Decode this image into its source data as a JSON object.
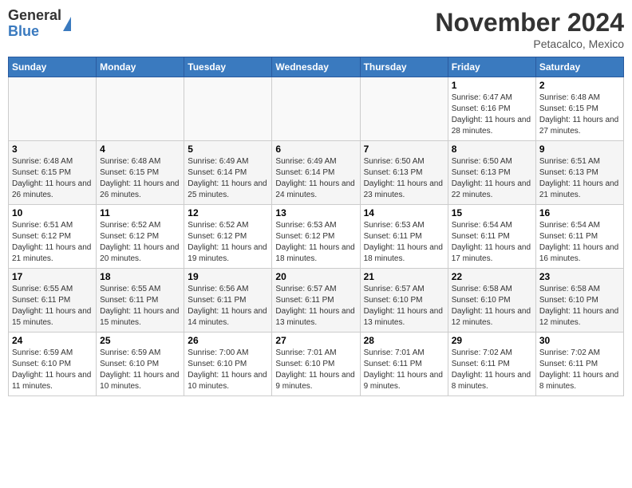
{
  "header": {
    "logo_general": "General",
    "logo_blue": "Blue",
    "month_title": "November 2024",
    "location": "Petacalco, Mexico"
  },
  "days_of_week": [
    "Sunday",
    "Monday",
    "Tuesday",
    "Wednesday",
    "Thursday",
    "Friday",
    "Saturday"
  ],
  "weeks": [
    [
      {
        "day": "",
        "info": ""
      },
      {
        "day": "",
        "info": ""
      },
      {
        "day": "",
        "info": ""
      },
      {
        "day": "",
        "info": ""
      },
      {
        "day": "",
        "info": ""
      },
      {
        "day": "1",
        "info": "Sunrise: 6:47 AM\nSunset: 6:16 PM\nDaylight: 11 hours and 28 minutes."
      },
      {
        "day": "2",
        "info": "Sunrise: 6:48 AM\nSunset: 6:15 PM\nDaylight: 11 hours and 27 minutes."
      }
    ],
    [
      {
        "day": "3",
        "info": "Sunrise: 6:48 AM\nSunset: 6:15 PM\nDaylight: 11 hours and 26 minutes."
      },
      {
        "day": "4",
        "info": "Sunrise: 6:48 AM\nSunset: 6:15 PM\nDaylight: 11 hours and 26 minutes."
      },
      {
        "day": "5",
        "info": "Sunrise: 6:49 AM\nSunset: 6:14 PM\nDaylight: 11 hours and 25 minutes."
      },
      {
        "day": "6",
        "info": "Sunrise: 6:49 AM\nSunset: 6:14 PM\nDaylight: 11 hours and 24 minutes."
      },
      {
        "day": "7",
        "info": "Sunrise: 6:50 AM\nSunset: 6:13 PM\nDaylight: 11 hours and 23 minutes."
      },
      {
        "day": "8",
        "info": "Sunrise: 6:50 AM\nSunset: 6:13 PM\nDaylight: 11 hours and 22 minutes."
      },
      {
        "day": "9",
        "info": "Sunrise: 6:51 AM\nSunset: 6:13 PM\nDaylight: 11 hours and 21 minutes."
      }
    ],
    [
      {
        "day": "10",
        "info": "Sunrise: 6:51 AM\nSunset: 6:12 PM\nDaylight: 11 hours and 21 minutes."
      },
      {
        "day": "11",
        "info": "Sunrise: 6:52 AM\nSunset: 6:12 PM\nDaylight: 11 hours and 20 minutes."
      },
      {
        "day": "12",
        "info": "Sunrise: 6:52 AM\nSunset: 6:12 PM\nDaylight: 11 hours and 19 minutes."
      },
      {
        "day": "13",
        "info": "Sunrise: 6:53 AM\nSunset: 6:12 PM\nDaylight: 11 hours and 18 minutes."
      },
      {
        "day": "14",
        "info": "Sunrise: 6:53 AM\nSunset: 6:11 PM\nDaylight: 11 hours and 18 minutes."
      },
      {
        "day": "15",
        "info": "Sunrise: 6:54 AM\nSunset: 6:11 PM\nDaylight: 11 hours and 17 minutes."
      },
      {
        "day": "16",
        "info": "Sunrise: 6:54 AM\nSunset: 6:11 PM\nDaylight: 11 hours and 16 minutes."
      }
    ],
    [
      {
        "day": "17",
        "info": "Sunrise: 6:55 AM\nSunset: 6:11 PM\nDaylight: 11 hours and 15 minutes."
      },
      {
        "day": "18",
        "info": "Sunrise: 6:55 AM\nSunset: 6:11 PM\nDaylight: 11 hours and 15 minutes."
      },
      {
        "day": "19",
        "info": "Sunrise: 6:56 AM\nSunset: 6:11 PM\nDaylight: 11 hours and 14 minutes."
      },
      {
        "day": "20",
        "info": "Sunrise: 6:57 AM\nSunset: 6:11 PM\nDaylight: 11 hours and 13 minutes."
      },
      {
        "day": "21",
        "info": "Sunrise: 6:57 AM\nSunset: 6:10 PM\nDaylight: 11 hours and 13 minutes."
      },
      {
        "day": "22",
        "info": "Sunrise: 6:58 AM\nSunset: 6:10 PM\nDaylight: 11 hours and 12 minutes."
      },
      {
        "day": "23",
        "info": "Sunrise: 6:58 AM\nSunset: 6:10 PM\nDaylight: 11 hours and 12 minutes."
      }
    ],
    [
      {
        "day": "24",
        "info": "Sunrise: 6:59 AM\nSunset: 6:10 PM\nDaylight: 11 hours and 11 minutes."
      },
      {
        "day": "25",
        "info": "Sunrise: 6:59 AM\nSunset: 6:10 PM\nDaylight: 11 hours and 10 minutes."
      },
      {
        "day": "26",
        "info": "Sunrise: 7:00 AM\nSunset: 6:10 PM\nDaylight: 11 hours and 10 minutes."
      },
      {
        "day": "27",
        "info": "Sunrise: 7:01 AM\nSunset: 6:10 PM\nDaylight: 11 hours and 9 minutes."
      },
      {
        "day": "28",
        "info": "Sunrise: 7:01 AM\nSunset: 6:11 PM\nDaylight: 11 hours and 9 minutes."
      },
      {
        "day": "29",
        "info": "Sunrise: 7:02 AM\nSunset: 6:11 PM\nDaylight: 11 hours and 8 minutes."
      },
      {
        "day": "30",
        "info": "Sunrise: 7:02 AM\nSunset: 6:11 PM\nDaylight: 11 hours and 8 minutes."
      }
    ]
  ]
}
